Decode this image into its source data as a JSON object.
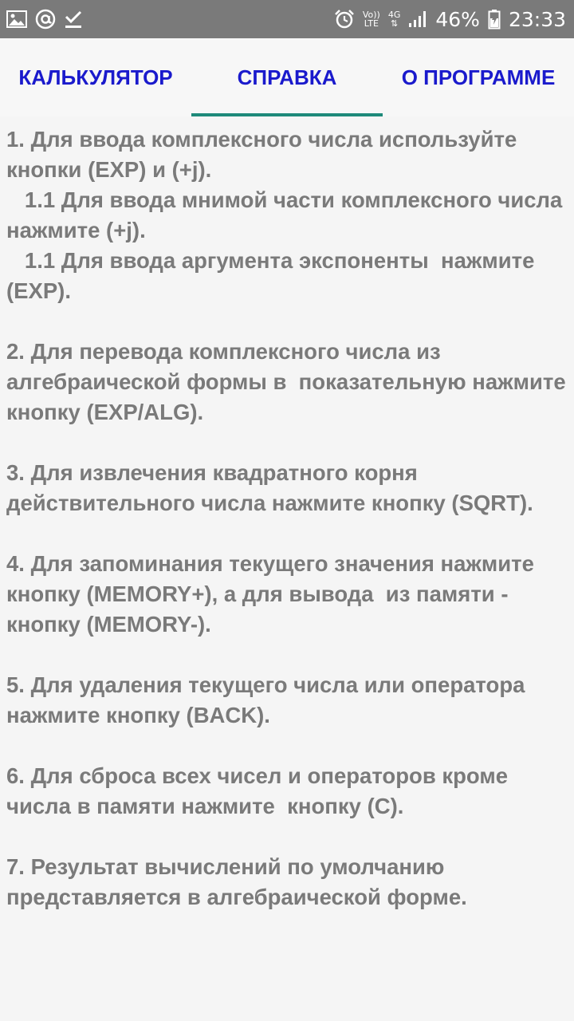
{
  "status_bar": {
    "icons_left": [
      "gallery-icon",
      "at-sign-icon",
      "download-done-icon"
    ],
    "volte_top": "Vo))",
    "volte_bottom": "LTE",
    "network": "4G",
    "battery_percent": "46%",
    "time": "23:33",
    "colors": {
      "background": "#7a7a7a",
      "foreground": "#ffffff"
    }
  },
  "tabs": {
    "items": [
      {
        "label": "КАЛЬКУЛЯТОР",
        "selected": false
      },
      {
        "label": "СПРАВКА",
        "selected": true
      },
      {
        "label": "О ПРОГРАММЕ",
        "selected": false
      }
    ],
    "colors": {
      "label": "#1a1acc",
      "indicator": "#1e8a7a"
    }
  },
  "help_text": "1. Для ввода комплексного числа используйте кнопки (EXP) и (+j).\n   1.1 Для ввода мнимой части комплексного числа нажмите (+j).\n   1.1 Для ввода аргумента экспоненты  нажмите (EXP).\n\n2. Для перевода комплексного числа из алгебраической формы в  показательную нажмите кнопку (EXP/ALG).\n\n3. Для извлечения квадратного корня действительного числа нажмите кнопку (SQRT).\n\n4. Для запоминания текущего значения нажмите кнопку (MEMORY+), а для вывода  из памяти - кнопку (MEMORY-).\n\n5. Для удаления текущего числа или оператора нажмите кнопку (BACK).\n\n6. Для сброса всех чисел и операторов кроме числа в памяти нажмите  кнопку (C).\n\n7. Результат вычислений по умолчанию представляется в алгебраической форме."
}
